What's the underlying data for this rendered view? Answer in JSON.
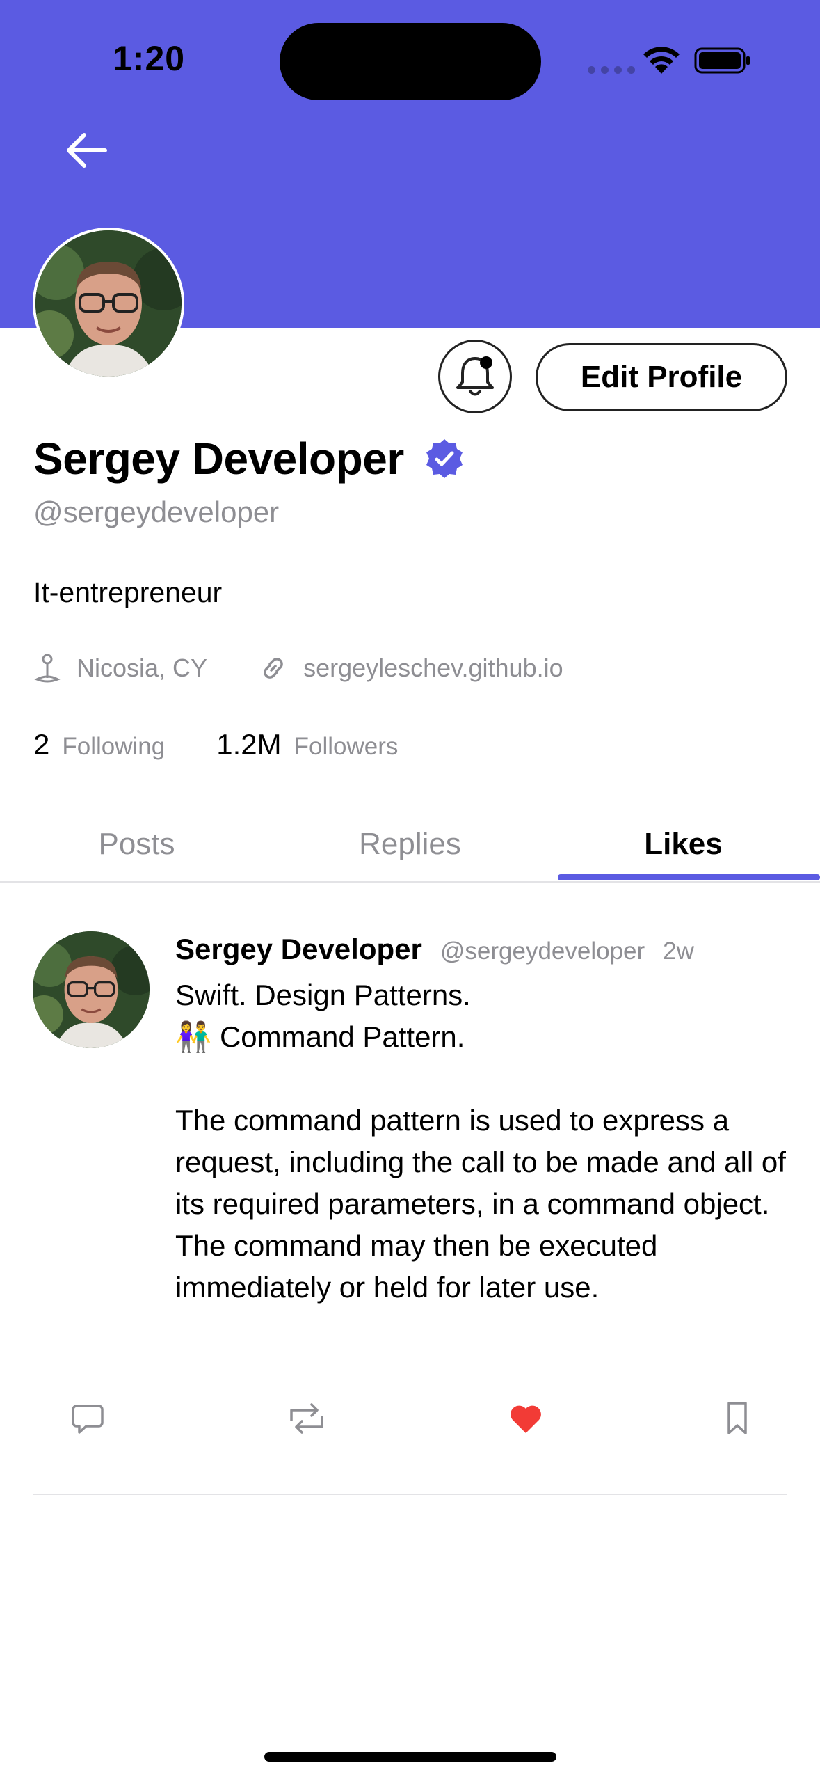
{
  "status_bar": {
    "time": "1:20"
  },
  "profile": {
    "display_name": "Sergey Developer",
    "handle": "@sergeydeveloper",
    "bio": "It-entrepreneur",
    "location": "Nicosia, CY",
    "website": "sergeyleschev.github.io",
    "edit_label": "Edit Profile",
    "following_count": "2",
    "following_label": "Following",
    "followers_count": "1.2M",
    "followers_label": "Followers"
  },
  "tabs": [
    {
      "label": "Posts"
    },
    {
      "label": "Replies"
    },
    {
      "label": "Likes"
    }
  ],
  "active_tab": "Likes",
  "post": {
    "author": "Sergey Developer",
    "handle": "@sergeydeveloper",
    "time": "2w",
    "text": "Swift. Design Patterns.\n👫 Command Pattern.\n\nThe command pattern is used to express a request, including the call to be made and all of its required parameters, in a command object. The command may then be executed immediately or held for later use.",
    "liked": true
  },
  "colors": {
    "accent": "#5B5BE2",
    "like": "#F23B36",
    "secondary_text": "#8E8E93"
  },
  "icons": [
    "back-arrow-icon",
    "bell-icon",
    "verified-badge-icon",
    "location-pin-icon",
    "link-icon",
    "reply-icon",
    "repost-icon",
    "heart-icon",
    "bookmark-icon"
  ]
}
